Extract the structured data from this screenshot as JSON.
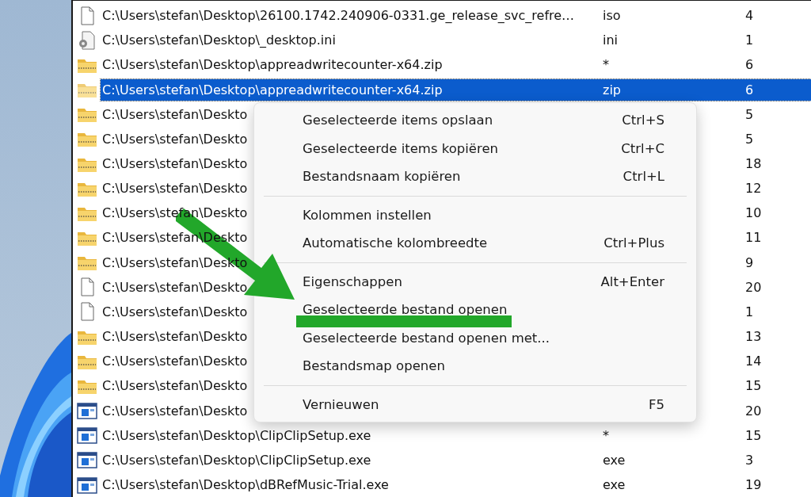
{
  "rows": [
    {
      "kind": "document",
      "selected": false,
      "column_1": "C:\\Users\\stefan\\Desktop\\26100.1742.240906-0331.ge_release_svc_refre…",
      "column_2": "iso",
      "column_3": "4"
    },
    {
      "kind": "settings-file",
      "selected": false,
      "column_1": "C:\\Users\\stefan\\Desktop\\_desktop.ini",
      "column_2": "ini",
      "column_3": "1"
    },
    {
      "kind": "zip",
      "selected": false,
      "column_1": "C:\\Users\\stefan\\Desktop\\appreadwritecounter-x64.zip",
      "column_2": "*",
      "column_3": "6"
    },
    {
      "kind": "zip",
      "selected": true,
      "column_1": "C:\\Users\\stefan\\Desktop\\appreadwritecounter-x64.zip",
      "column_2": "zip",
      "column_3": "6"
    },
    {
      "kind": "zip",
      "selected": false,
      "column_1": "C:\\Users\\stefan\\Deskto",
      "column_3": "5"
    },
    {
      "kind": "zip",
      "selected": false,
      "column_1": "C:\\Users\\stefan\\Deskto",
      "column_3": "5"
    },
    {
      "kind": "zip",
      "selected": false,
      "column_1": "C:\\Users\\stefan\\Deskto",
      "column_3": "18"
    },
    {
      "kind": "zip",
      "selected": false,
      "column_1": "C:\\Users\\stefan\\Deskto",
      "column_3": "12"
    },
    {
      "kind": "zip",
      "selected": false,
      "column_1": "C:\\Users\\stefan\\Deskto",
      "column_3": "10"
    },
    {
      "kind": "zip",
      "selected": false,
      "column_1": "C:\\Users\\stefan\\Deskto",
      "column_3": "11"
    },
    {
      "kind": "zip",
      "selected": false,
      "column_1": "C:\\Users\\stefan\\Deskto",
      "column_3": "9"
    },
    {
      "kind": "document",
      "selected": false,
      "column_1": "C:\\Users\\stefan\\Deskto",
      "column_3": "20"
    },
    {
      "kind": "document",
      "selected": false,
      "column_1": "C:\\Users\\stefan\\Deskto",
      "column_3": "1"
    },
    {
      "kind": "zip",
      "selected": false,
      "column_1": "C:\\Users\\stefan\\Deskto",
      "column_3": "13"
    },
    {
      "kind": "zip",
      "selected": false,
      "column_1": "C:\\Users\\stefan\\Deskto",
      "column_3": "14"
    },
    {
      "kind": "zip",
      "selected": false,
      "column_1": "C:\\Users\\stefan\\Deskto",
      "column_3": "15"
    },
    {
      "kind": "program",
      "selected": false,
      "column_1": "C:\\Users\\stefan\\Deskto",
      "column_3": "20"
    },
    {
      "kind": "program",
      "selected": false,
      "column_1": "C:\\Users\\stefan\\Desktop\\ClipClipSetup.exe",
      "column_2": "*",
      "column_3": "15"
    },
    {
      "kind": "program",
      "selected": false,
      "column_1": "C:\\Users\\stefan\\Desktop\\ClipClipSetup.exe",
      "column_2": "exe",
      "column_3": "3"
    },
    {
      "kind": "program",
      "selected": false,
      "column_1": "C:\\Users\\stefan\\Desktop\\dBRefMusic-Trial.exe",
      "column_2": "exe",
      "column_3": "19"
    }
  ],
  "context_menu": {
    "items": [
      {
        "kind": "item",
        "label": "Geselecteerde items opslaan",
        "shortcut": "Ctrl+S"
      },
      {
        "kind": "item",
        "label": "Geselecteerde items kopiëren",
        "shortcut": "Ctrl+C"
      },
      {
        "kind": "item",
        "label": "Bestandsnaam kopiëren",
        "shortcut": "Ctrl+L"
      },
      {
        "kind": "separator"
      },
      {
        "kind": "item",
        "label": "Kolommen instellen"
      },
      {
        "kind": "item",
        "label": "Automatische kolombreedte",
        "shortcut": "Ctrl+Plus"
      },
      {
        "kind": "separator"
      },
      {
        "kind": "item",
        "label": "Eigenschappen",
        "shortcut": "Alt+Enter"
      },
      {
        "kind": "item",
        "label": "Geselecteerde bestand openen"
      },
      {
        "kind": "item",
        "label": "Geselecteerde bestand openen met..."
      },
      {
        "kind": "item",
        "label": "Bestandsmap openen"
      },
      {
        "kind": "separator"
      },
      {
        "kind": "item",
        "label": "Vernieuwen",
        "shortcut": "F5"
      }
    ]
  }
}
